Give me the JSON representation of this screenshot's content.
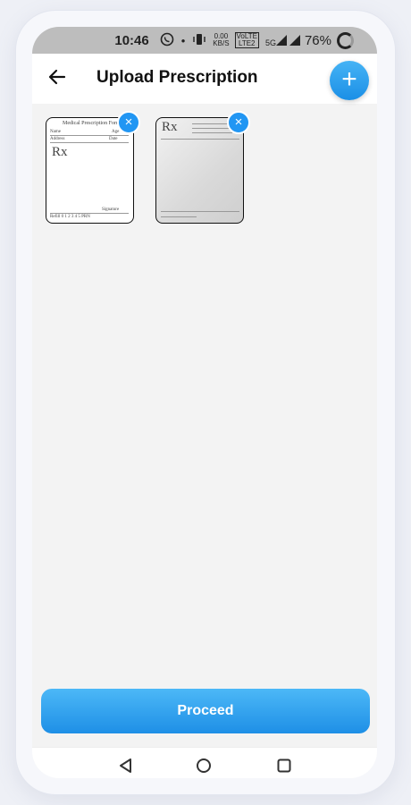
{
  "status": {
    "time": "10:46",
    "whatsapp_icon": "whatsapp-icon",
    "dot": "•",
    "speed_top": "0.00",
    "speed_bottom": "KB/S",
    "volte_top": "VoLTE",
    "volte_bottom": "LTE2",
    "signal": "5G",
    "battery": "76%"
  },
  "appbar": {
    "title": "Upload Prescription",
    "add_symbol": "+"
  },
  "thumbnails": [
    {
      "heading": "Medical Prescription Form",
      "name": "Name",
      "age": "Age",
      "address": "Address",
      "date": "Date",
      "rx": "Rx",
      "signature": "Signature",
      "refill": "Refill 0 1 2 3 4 5 PRN",
      "remove": "×"
    },
    {
      "rx": "Rx",
      "remove": "×"
    }
  ],
  "actions": {
    "proceed": "Proceed"
  },
  "colors": {
    "accent": "#2196f3",
    "status_bg": "#bdbdbd",
    "content_bg": "#f3f3f3"
  }
}
